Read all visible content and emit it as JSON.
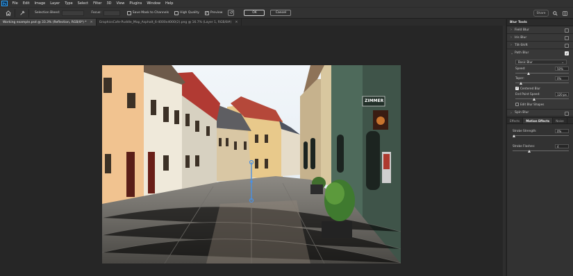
{
  "menubar": {
    "logo": "Ps",
    "items": [
      "File",
      "Edit",
      "Image",
      "Layer",
      "Type",
      "Select",
      "Filter",
      "3D",
      "View",
      "Plugins",
      "Window",
      "Help"
    ]
  },
  "options": {
    "selection_bleed": "Selection Bleed:",
    "focus": "Focus:",
    "save_mask": "Save Mask to Channels",
    "high_quality": "High Quality",
    "preview": "Preview",
    "ok": "OK",
    "cancel": "Cancel",
    "share": "Share"
  },
  "tabs": [
    {
      "label": "Working example.psd @ 33.3% (Reflection, RGB/8*) *",
      "close": "×"
    },
    {
      "label": "GraphicsCafe-Puddle_Map_Asphalt_6-4000x4000(2).png @ 16.7% (Layer 1, RGB/8#)",
      "close": "×"
    }
  ],
  "panel": {
    "title": "Blur Tools",
    "blurs": [
      {
        "label": "Field Blur",
        "checked": false
      },
      {
        "label": "Iris Blur",
        "checked": false
      },
      {
        "label": "Tilt-Shift",
        "checked": false
      },
      {
        "label": "Path Blur",
        "checked": true
      },
      {
        "label": "Spin Blur",
        "checked": false
      }
    ],
    "path": {
      "type": "Basic Blur",
      "speed_label": "Speed:",
      "speed_value": "50%",
      "speed_fraction": 0.25,
      "taper_label": "Taper:",
      "taper_value": "0%",
      "taper_fraction": 0.1,
      "centered": "Centered Blur",
      "end_speed_label": "End Point Speed:",
      "end_speed_value": "120 px",
      "end_speed_fraction": 0.35,
      "edit_shapes": "Edit Blur Shapes"
    },
    "fx_tabs": [
      "Effects",
      "Motion Effects",
      "Noise"
    ],
    "motion": {
      "strobe_strength_label": "Strobe Strength:",
      "strobe_strength_value": "0%",
      "strobe_strength_fraction": 0.02,
      "strobe_flashes_label": "Strobe Flashes:",
      "strobe_flashes_value": "4",
      "strobe_flashes_fraction": 0.3
    }
  },
  "colors": {
    "accent": "#31a8ff",
    "pin": "#4a90e2"
  }
}
